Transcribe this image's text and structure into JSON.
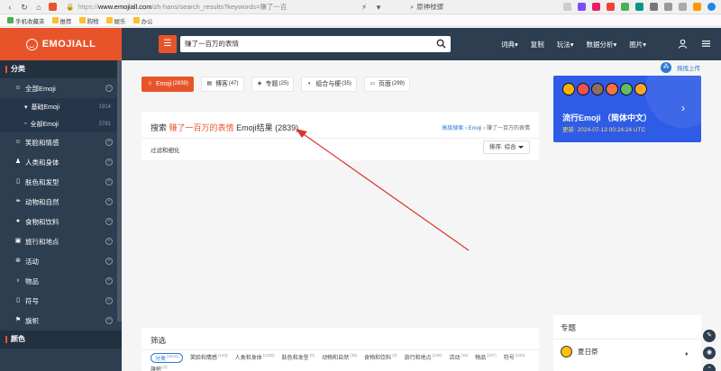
{
  "browser": {
    "url_scheme": "https://",
    "url_domain": "www.emojiall.com",
    "url_path": "/zh-hans/search_results?keywords=赚了一百",
    "search_engine_text": "原神枝骤"
  },
  "bookmarks": [
    {
      "label": "手机收藏夹",
      "icon": "phone-icon"
    },
    {
      "label": "推荐",
      "icon": "folder-icon"
    },
    {
      "label": "购物",
      "icon": "folder-icon"
    },
    {
      "label": "娱乐",
      "icon": "folder-icon"
    },
    {
      "label": "办公",
      "icon": "folder-icon"
    }
  ],
  "header": {
    "logo": "EMOJIALL",
    "search_value": "赚了一百万的表情",
    "nav": [
      "词典▾",
      "复制",
      "玩法▾",
      "数据分析▾",
      "图片▾"
    ]
  },
  "sidebar": {
    "section_category": "分类",
    "section_emoji": "颜色",
    "all_emoji": "全部Emoji",
    "sub_items": [
      {
        "label": "基础Emoji",
        "count": "1914"
      },
      {
        "label": "全部Emoji",
        "count": "3781"
      }
    ],
    "items": [
      {
        "label": "笑脸和情感",
        "icon": "smile-icon"
      },
      {
        "label": "人类和身体",
        "icon": "person-icon"
      },
      {
        "label": "肤色和发型",
        "icon": "skin-icon"
      },
      {
        "label": "动物和自然",
        "icon": "paw-icon"
      },
      {
        "label": "食物和饮料",
        "icon": "food-icon"
      },
      {
        "label": "旅行和地点",
        "icon": "car-icon"
      },
      {
        "label": "活动",
        "icon": "ball-icon"
      },
      {
        "label": "物品",
        "icon": "bulb-icon"
      },
      {
        "label": "符号",
        "icon": "symbol-icon"
      },
      {
        "label": "旗帜",
        "icon": "flag-icon"
      }
    ]
  },
  "tabs": [
    {
      "label": "Emoji",
      "count": "(2839)",
      "active": true,
      "icon": "smile-icon"
    },
    {
      "label": "博客",
      "count": "(47)",
      "active": false,
      "icon": "blog-icon"
    },
    {
      "label": "专题",
      "count": "(25)",
      "active": false,
      "icon": "tag-icon"
    },
    {
      "label": "组合与梗",
      "count": "(35)",
      "active": false,
      "icon": "combo-icon"
    },
    {
      "label": "页面",
      "count": "(299)",
      "active": false,
      "icon": "page-icon"
    }
  ],
  "results": {
    "prefix": "搜索",
    "keyword": "赚了一百万的表情",
    "suffix": "Emoji结果 (2839)",
    "breadcrumb_link": "高级搜索",
    "breadcrumb_mid": "Emoji",
    "breadcrumb_last": "赚了一百万的表情",
    "filter_label": "过滤和细化",
    "sort_label": "排序: 综合"
  },
  "screening": {
    "title": "筛选",
    "chips": [
      {
        "label": "分类",
        "count": "(2534)",
        "active": true
      },
      {
        "label": "笑脸和情感",
        "count": "(133)"
      },
      {
        "label": "人类和身体",
        "count": "(1335)"
      },
      {
        "label": "肤色和发型",
        "count": "(6)"
      },
      {
        "label": "动物和自然",
        "count": "(39)"
      },
      {
        "label": "食物和饮料",
        "count": "(9)"
      },
      {
        "label": "旅行和地点",
        "count": "(248)"
      },
      {
        "label": "活动",
        "count": "(46)"
      },
      {
        "label": "物品",
        "count": "(237)"
      },
      {
        "label": "符号",
        "count": "(233)"
      },
      {
        "label": "旗帜",
        "count": "(2)"
      }
    ]
  },
  "right": {
    "upload_label": "拖拽上传",
    "trend_title": "流行Emoji （简体中文）",
    "trend_date": "更新: 2024-07-13 00:24:24 UTC",
    "topic_title": "专题",
    "topic_item": "夏日祭"
  },
  "colors": {
    "brand": "#e8542a",
    "header_bg": "#2d3e50",
    "trend_bg": "#2e5ce6",
    "link": "#2a7ad1",
    "annotation": "#d9342b"
  }
}
